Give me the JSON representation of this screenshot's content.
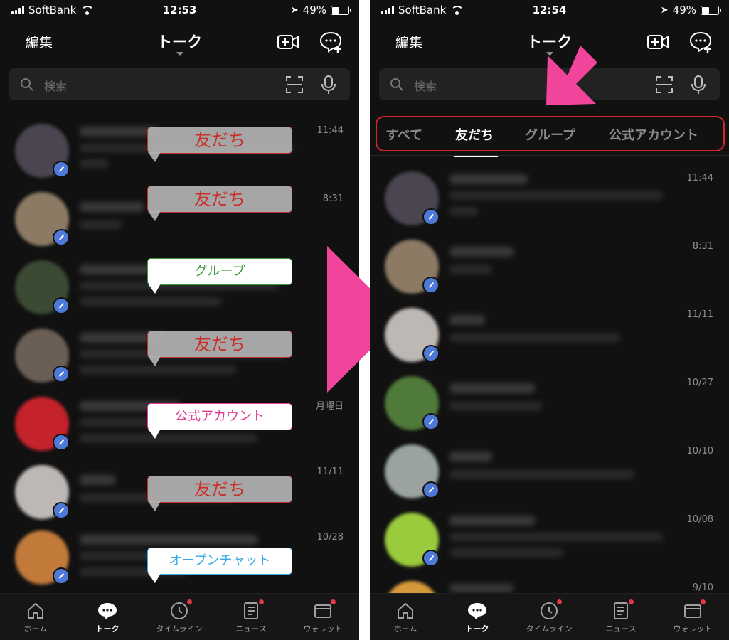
{
  "colors": {
    "background": "#111111",
    "accent_pink": "#f0459a",
    "tab_highlight_border": "#d3262b",
    "badge_blue": "#4e79d6",
    "notification_dot": "#e23a46"
  },
  "left": {
    "status": {
      "carrier": "SoftBank",
      "time": "12:53",
      "battery": "49%",
      "battery_level": 0.49
    },
    "header": {
      "edit": "編集",
      "title": "トーク"
    },
    "search": {
      "placeholder": "検索"
    },
    "chats": [
      {
        "time": "11:44",
        "avatar_color": "#4a4550"
      },
      {
        "time": "8:31",
        "avatar_color": "#8c7a64"
      },
      {
        "time": "",
        "avatar_color": "#3b4a33"
      },
      {
        "time": "",
        "avatar_color": "#6b5f55"
      },
      {
        "time": "月曜日",
        "avatar_color": "#c4232c"
      },
      {
        "time": "11/11",
        "avatar_color": "#bdb8b4"
      },
      {
        "time": "10/28",
        "avatar_color": "#c27a3a"
      }
    ],
    "callouts": [
      "友だち",
      "友だち",
      "グループ",
      "友だち",
      "公式アカウント",
      "友だち",
      "オープンチャット"
    ]
  },
  "right": {
    "status": {
      "carrier": "SoftBank",
      "time": "12:54",
      "battery": "49%",
      "battery_level": 0.49
    },
    "header": {
      "edit": "編集",
      "title": "トーク"
    },
    "search": {
      "placeholder": "検索"
    },
    "tabs": [
      {
        "label": "すべて",
        "active": false
      },
      {
        "label": "友だち",
        "active": true
      },
      {
        "label": "グループ",
        "active": false
      },
      {
        "label": "公式アカウント",
        "active": false
      }
    ],
    "chats": [
      {
        "time": "11:44",
        "avatar_color": "#4a4550"
      },
      {
        "time": "8:31",
        "avatar_color": "#8c7a64"
      },
      {
        "time": "11/11",
        "avatar_color": "#bdb8b4"
      },
      {
        "time": "10/27",
        "avatar_color": "#4f7a3a"
      },
      {
        "time": "10/10",
        "avatar_color": "#9aa3a0"
      },
      {
        "time": "10/08",
        "avatar_color": "#9acb3c"
      },
      {
        "time": "9/10",
        "avatar_color": "#d79a3a"
      }
    ]
  },
  "bottom_nav": [
    {
      "label": "ホーム",
      "icon": "home-icon",
      "active": false,
      "dot": false
    },
    {
      "label": "トーク",
      "icon": "chat-bubble-icon",
      "active": true,
      "dot": false
    },
    {
      "label": "タイムライン",
      "icon": "clock-icon",
      "active": false,
      "dot": true
    },
    {
      "label": "ニュース",
      "icon": "news-icon",
      "active": false,
      "dot": true
    },
    {
      "label": "ウォレット",
      "icon": "wallet-icon",
      "active": false,
      "dot": true
    }
  ]
}
